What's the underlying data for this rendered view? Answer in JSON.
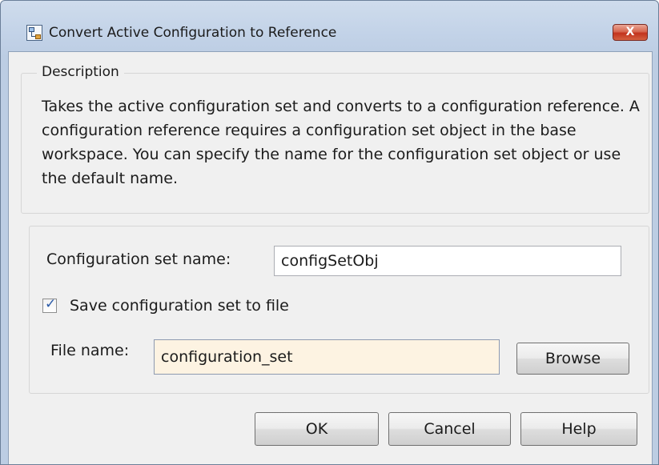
{
  "window": {
    "title": "Convert Active Configuration to Reference",
    "close_label": "X",
    "icon": "model-block-icon"
  },
  "description": {
    "legend": "Description",
    "text": "Takes the active configuration set and converts to a configuration reference. A configuration reference requires a configuration set object in the base workspace. You can specify the name for the configuration set object or use the default name."
  },
  "form": {
    "config_name_label": "Configuration set name:",
    "config_name_value": "configSetObj",
    "save_checkbox_label": "Save configuration set to file",
    "save_checkbox_checked": true,
    "file_name_label": "File name:",
    "file_name_value": "configuration_set",
    "browse_label": "Browse"
  },
  "buttons": {
    "ok": "OK",
    "cancel": "Cancel",
    "help": "Help"
  }
}
